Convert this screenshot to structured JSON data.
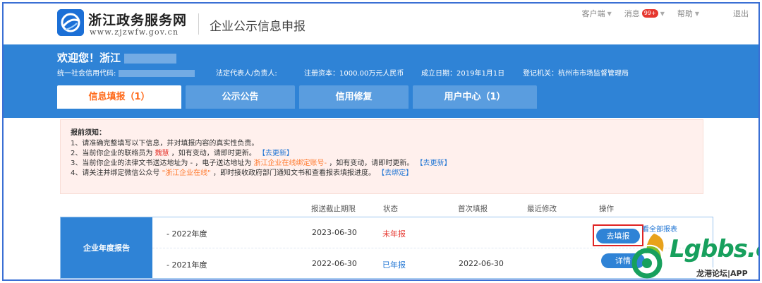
{
  "header": {
    "site_name": "浙江政务服务网",
    "site_url": "www.zjzwfw.gov.cn",
    "system_title": "企业公示信息申报",
    "nav": {
      "client": "客户端",
      "messages": "消息",
      "messages_badge": "99+",
      "help": "帮助",
      "logout": "退出"
    }
  },
  "banner": {
    "welcome": "欢迎您！浙江",
    "credit_code_label": "统一社会信用代码:",
    "legal_rep_label": "法定代表人/负责人:",
    "capital": "注册资本：1000.00万元人民币",
    "founded": "成立日期：2019年1月1日",
    "authority": "登记机关：杭州市市场监督管理局"
  },
  "tabs": [
    {
      "label": "信息填报（1）",
      "active": true
    },
    {
      "label": "公示公告",
      "active": false
    },
    {
      "label": "信用修复",
      "active": false
    },
    {
      "label": "用户中心（1）",
      "active": false
    }
  ],
  "notice": {
    "title": "报前须知：",
    "line1": "1、请准确完整填写以下信息，并对填报内容的真实性负责。",
    "line2_a": "2、当前你企业的联络员为",
    "line2_name": "魏慧",
    "line2_b": "，如有变动，请即时更新。",
    "line2_link": "【去更新】",
    "line3_a": "3、当前你企业的法律文书送达地址为 - ，电子送达地址为",
    "line3_orange": "浙江企业在线绑定账号-",
    "line3_b": "，如有变动，请即时更新。",
    "line3_link": "【去更新】",
    "line4_a": "4、请关注并绑定微信公众号",
    "line4_orange": "\"浙江企业在线\"",
    "line4_b": "，即时接收政府部门通知文书和查看报表填报进度。",
    "line4_link": "【去绑定】"
  },
  "table": {
    "headers": {
      "deadline": "报送截止期限",
      "status": "状态",
      "first_filed": "首次填报",
      "last_modified": "最近修改",
      "action": "操作"
    },
    "section_label": "企业年度报告",
    "rows": [
      {
        "year": "- 2022年度",
        "deadline": "2023-06-30",
        "status": "未年报",
        "first_filed": "",
        "action": "去填报"
      },
      {
        "year": "- 2021年度",
        "deadline": "2022-06-30",
        "status": "已年报",
        "first_filed": "2022-06-30",
        "action": "详情"
      }
    ],
    "all_reports_link": "看全部报表"
  },
  "watermark": {
    "brand": "Lgbbs.cn",
    "sub": "龙港论坛|APP"
  },
  "colors": {
    "primary_blue": "#2f83d6",
    "active_orange": "#ff6a1a",
    "alert_red": "#e6372f",
    "watermark_green": "#17a05d"
  }
}
